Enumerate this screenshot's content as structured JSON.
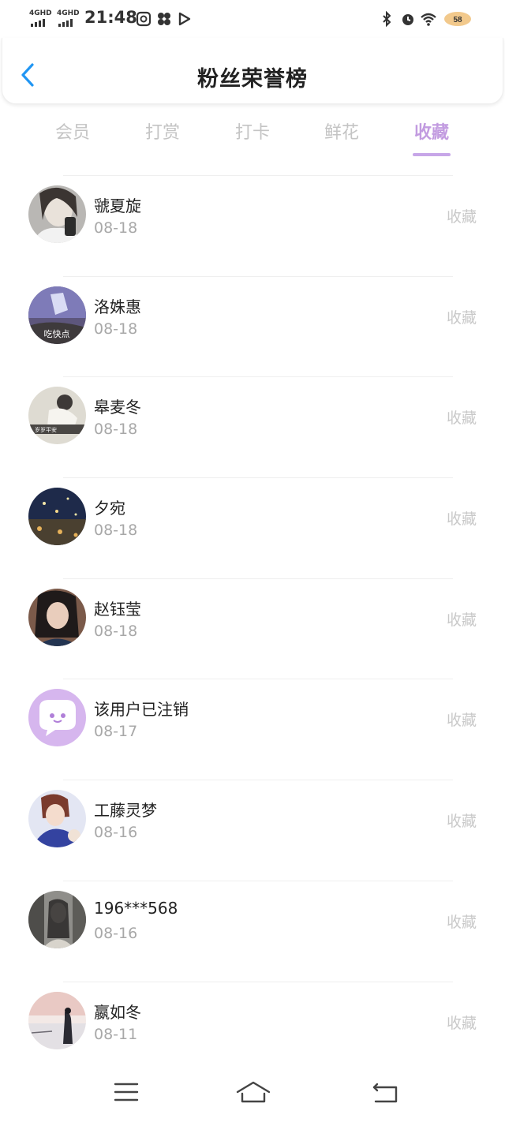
{
  "status_bar": {
    "net1": "4GHD",
    "net2": "4GHD",
    "time": "21:48",
    "battery": "58"
  },
  "header": {
    "title": "粉丝荣誉榜"
  },
  "tabs": [
    {
      "label": "会员",
      "active": false
    },
    {
      "label": "打赏",
      "active": false
    },
    {
      "label": "打卡",
      "active": false
    },
    {
      "label": "鲜花",
      "active": false
    },
    {
      "label": "收藏",
      "active": true
    }
  ],
  "fans": [
    {
      "name": "虢夏旋",
      "date": "08-18",
      "action": "收藏",
      "avatar_text": ""
    },
    {
      "name": "洛姝惠",
      "date": "08-18",
      "action": "收藏",
      "avatar_text": "吃快点"
    },
    {
      "name": "皋麦冬",
      "date": "08-18",
      "action": "收藏",
      "avatar_text": "岁岁平安"
    },
    {
      "name": "夕宛",
      "date": "08-18",
      "action": "收藏",
      "avatar_text": ""
    },
    {
      "name": "赵钰莹",
      "date": "08-18",
      "action": "收藏",
      "avatar_text": ""
    },
    {
      "name": "该用户已注销",
      "date": "08-17",
      "action": "收藏",
      "avatar_text": ""
    },
    {
      "name": "工藤灵梦",
      "date": "08-16",
      "action": "收藏",
      "avatar_text": ""
    },
    {
      "name": "196***568",
      "date": "08-16",
      "action": "收藏",
      "avatar_text": ""
    },
    {
      "name": "嬴如冬",
      "date": "08-11",
      "action": "收藏",
      "avatar_text": ""
    }
  ],
  "colors": {
    "accent": "#c29be0",
    "back_arrow": "#2196f3",
    "inactive_tab": "#c4c4c4"
  }
}
